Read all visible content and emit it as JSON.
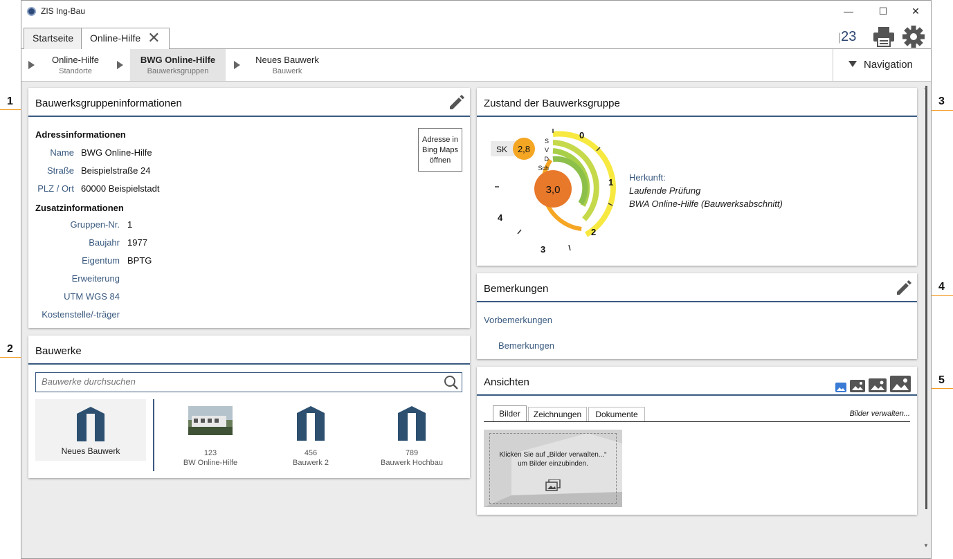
{
  "window": {
    "title": "ZIS Ing-Bau",
    "minimize": "—",
    "maximize": "☐",
    "close": "✕"
  },
  "tabs": [
    {
      "label": "Startseite"
    },
    {
      "label": "Online-Hilfe"
    }
  ],
  "toolbar": {
    "counter_a": "2",
    "counter_b": "3"
  },
  "breadcrumb": [
    {
      "title": "Online-Hilfe",
      "subtitle": "Standorte"
    },
    {
      "title": "BWG Online-Hilfe",
      "subtitle": "Bauwerksgruppen"
    },
    {
      "title": "Neues Bauwerk",
      "subtitle": "Bauwerk"
    }
  ],
  "navigation": {
    "label": "Navigation"
  },
  "info_card": {
    "title": "Bauwerksgruppeninformationen",
    "bing_button": "Adresse in Bing Maps öffnen",
    "address_header": "Adressinformationen",
    "address": [
      {
        "label": "Name",
        "value": "BWG Online-Hilfe"
      },
      {
        "label": "Straße",
        "value": "Beispielstraße 24"
      },
      {
        "label": "PLZ / Ort",
        "value": "60000 Beispielstadt"
      }
    ],
    "extra_header": "Zusatzinformationen",
    "extra": [
      {
        "label": "Gruppen-Nr.",
        "value": "1"
      },
      {
        "label": "Baujahr",
        "value": "1977"
      },
      {
        "label": "Eigentum",
        "value": "BPTG"
      },
      {
        "label": "Erweiterung",
        "value": ""
      },
      {
        "label": "UTM WGS 84",
        "value": ""
      },
      {
        "label": "Kostenstelle/-träger",
        "value": ""
      }
    ]
  },
  "bauwerke_card": {
    "title": "Bauwerke",
    "search_placeholder": "Bauwerke durchsuchen",
    "new_label": "Neues Bauwerk",
    "items": [
      {
        "number": "123",
        "name": "BW Online-Hilfe"
      },
      {
        "number": "456",
        "name": "Bauwerk 2"
      },
      {
        "number": "789",
        "name": "Bauwerk Hochbau"
      }
    ]
  },
  "zustand_card": {
    "title": "Zustand der Bauwerksgruppe",
    "sk_label": "SK",
    "sk_value": "2,8",
    "center_value": "3,0",
    "ring_labels": [
      "S",
      "V",
      "D",
      "Sch"
    ],
    "scale": [
      "0",
      "1",
      "2",
      "3",
      "4"
    ],
    "herkunft_label": "Herkunft:",
    "herkunft_line1": "Laufende Prüfung",
    "herkunft_line2": "BWA Online-Hilfe (Bauwerksabschnitt)"
  },
  "bemerkungen_card": {
    "title": "Bemerkungen",
    "vorbemerkungen": "Vorbemerkungen",
    "bemerkungen": "Bemerkungen"
  },
  "ansichten_card": {
    "title": "Ansichten",
    "tabs": [
      "Bilder",
      "Zeichnungen",
      "Dokumente"
    ],
    "manage_link": "Bilder verwalten...",
    "placeholder_line1": "Klicken Sie auf „Bilder verwalten...“",
    "placeholder_line2": "um Bilder einzubinden."
  },
  "callouts": [
    "1",
    "2",
    "3",
    "4",
    "5"
  ],
  "colors": {
    "accent": "#3a5a80",
    "orange": "#f39a1e",
    "yellow": "#f7e940",
    "lime": "#c6d94a",
    "green": "#8cc04a"
  }
}
